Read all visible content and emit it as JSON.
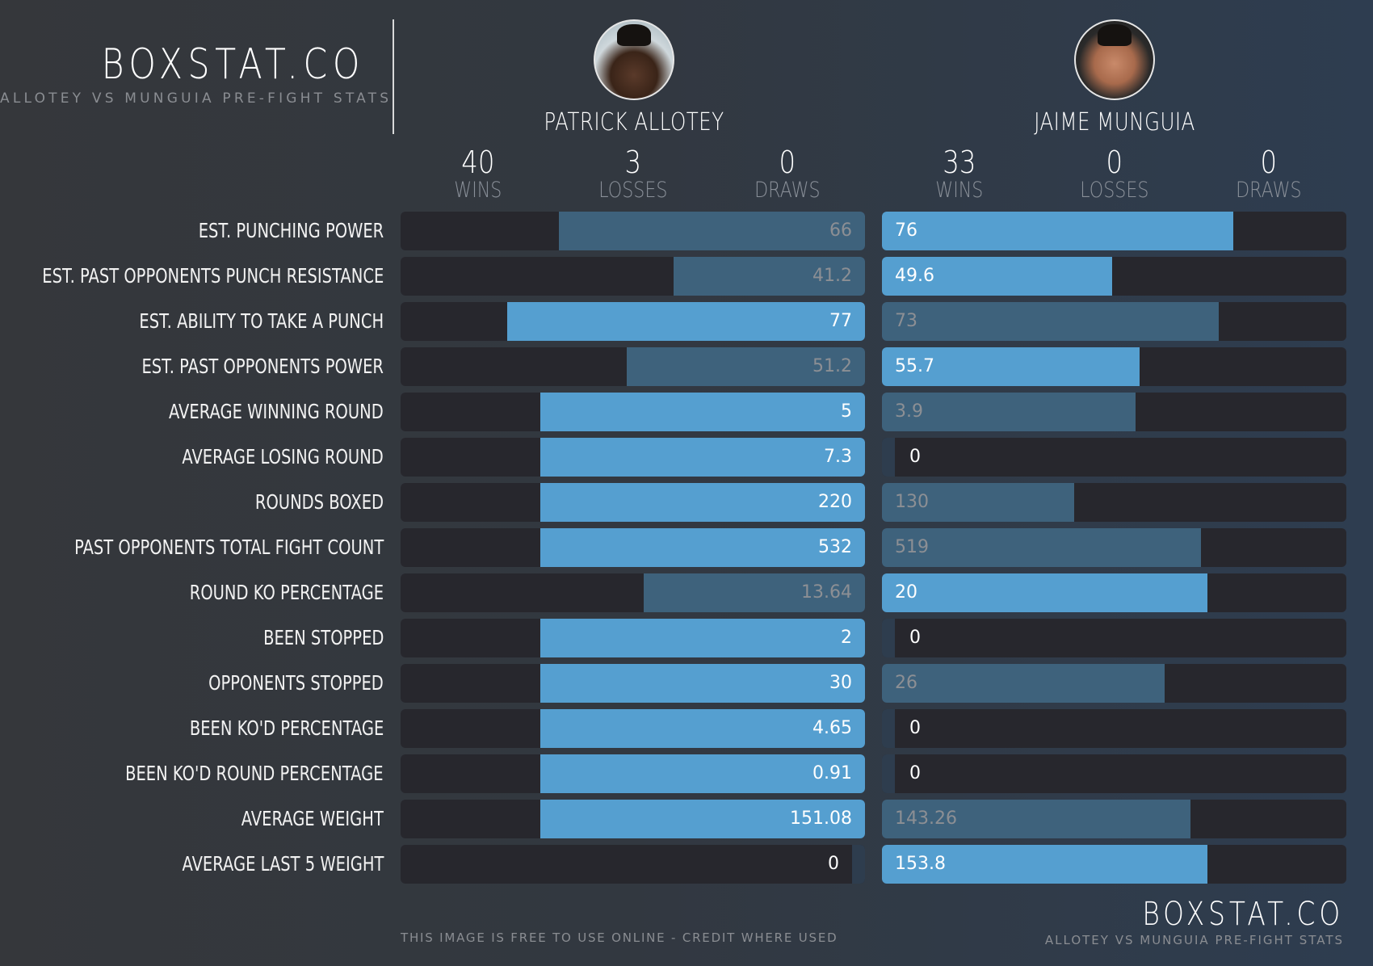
{
  "header": {
    "brand": "BOXSTAT.CO",
    "subtitle": "ALLOTEY VS MUNGUIA PRE-FIGHT STATS"
  },
  "fighters": [
    {
      "name": "PATRICK ALLOTEY",
      "avatar_icon": "fighter-portrait",
      "record": [
        {
          "value": "40",
          "label": "WINS"
        },
        {
          "value": "3",
          "label": "LOSSES"
        },
        {
          "value": "0",
          "label": "DRAWS"
        }
      ]
    },
    {
      "name": "JAIME MUNGUIA",
      "avatar_icon": "fighter-portrait",
      "record": [
        {
          "value": "33",
          "label": "WINS"
        },
        {
          "value": "0",
          "label": "LOSSES"
        },
        {
          "value": "0",
          "label": "DRAWS"
        }
      ]
    }
  ],
  "colors": {
    "leader_bar": "#559fd0",
    "trailer_bar": "#3e627c",
    "track": "#27272d",
    "zero_stub": "#2e3d4e"
  },
  "chart_data": {
    "type": "bar",
    "title": "ALLOTEY VS MUNGUIA PRE-FIGHT STATS",
    "orientation": "horizontal-mirrored",
    "categories": [
      "EST. PUNCHING POWER",
      "EST. PAST OPPONENTS PUNCH RESISTANCE",
      "EST. ABILITY TO TAKE A PUNCH",
      "EST. PAST OPPONENTS POWER",
      "AVERAGE WINNING ROUND",
      "AVERAGE LOSING ROUND",
      "ROUNDS BOXED",
      "PAST OPPONENTS TOTAL FIGHT COUNT",
      "ROUND KO PERCENTAGE",
      "BEEN STOPPED",
      "OPPONENTS STOPPED",
      "BEEN KO'D PERCENTAGE",
      "BEEN KO'D ROUND PERCENTAGE",
      "AVERAGE WEIGHT",
      "AVERAGE LAST 5 WEIGHT"
    ],
    "series": [
      {
        "name": "PATRICK ALLOTEY",
        "values": [
          "66",
          "41.2",
          "77",
          "51.2",
          "5",
          "7.3",
          "220",
          "532",
          "13.64",
          "2",
          "30",
          "4.65",
          "0.91",
          "151.08",
          "0"
        ],
        "fill_fraction": [
          0.66,
          0.412,
          0.77,
          0.513,
          0.7,
          0.7,
          0.7,
          0.7,
          0.477,
          0.7,
          0.7,
          0.7,
          0.7,
          0.7,
          0
        ],
        "leader": [
          false,
          false,
          true,
          false,
          true,
          true,
          true,
          true,
          false,
          true,
          true,
          true,
          true,
          true,
          false
        ]
      },
      {
        "name": "JAIME MUNGUIA",
        "values": [
          "76",
          "49.6",
          "73",
          "55.7",
          "3.9",
          "0",
          "130",
          "519",
          "20",
          "0",
          "26",
          "0",
          "0",
          "143.26",
          "153.8"
        ],
        "fill_fraction": [
          0.757,
          0.496,
          0.726,
          0.555,
          0.546,
          0,
          0.414,
          0.687,
          0.7,
          0,
          0.609,
          0,
          0,
          0.664,
          0.7
        ],
        "leader": [
          true,
          true,
          false,
          true,
          false,
          false,
          false,
          false,
          true,
          false,
          false,
          false,
          false,
          false,
          true
        ]
      }
    ],
    "legend": "none",
    "grid": false
  },
  "footer": {
    "note": "THIS IMAGE IS FREE TO USE ONLINE -  CREDIT WHERE USED",
    "brand": "BOXSTAT.CO",
    "subtitle": "ALLOTEY VS MUNGUIA PRE-FIGHT STATS"
  }
}
